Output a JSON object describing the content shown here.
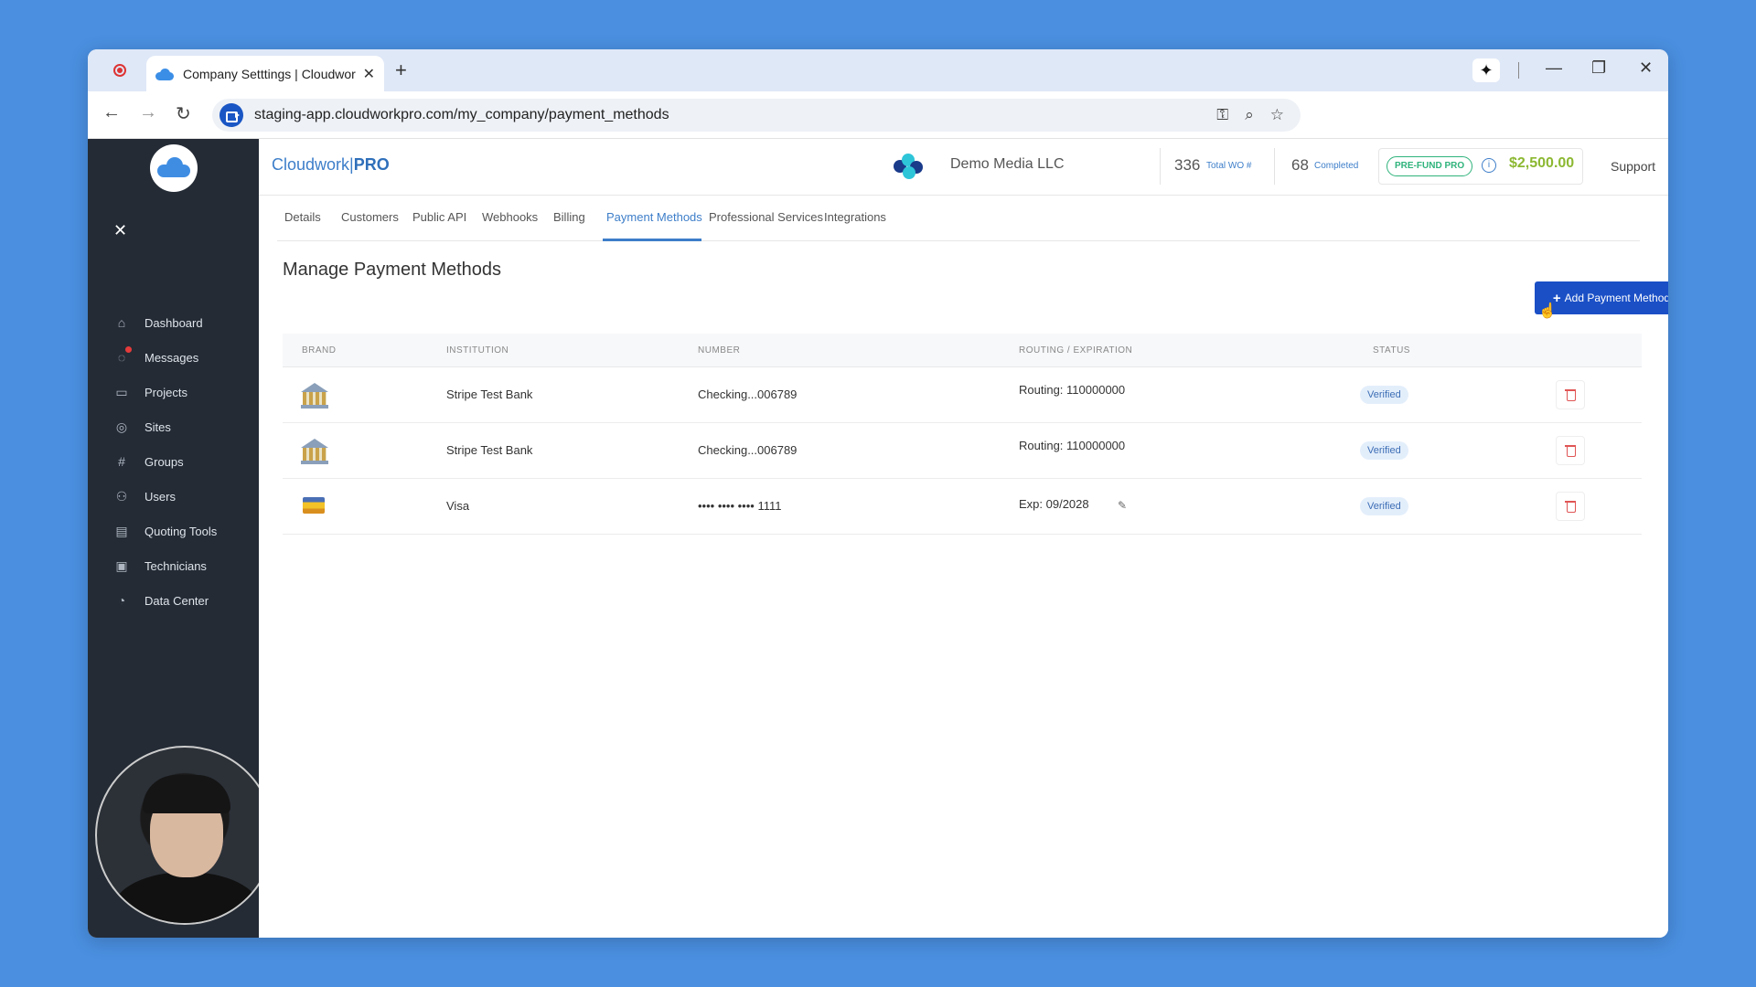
{
  "browser": {
    "tab_title": "Company Setttings | Cloudwork",
    "url": "staging-app.cloudworkpro.com/my_company/payment_methods"
  },
  "sidebar": {
    "items": [
      {
        "label": "Dashboard",
        "icon": "home-icon"
      },
      {
        "label": "Messages",
        "icon": "chat-icon"
      },
      {
        "label": "Projects",
        "icon": "folder-icon"
      },
      {
        "label": "Sites",
        "icon": "location-pin-icon"
      },
      {
        "label": "Groups",
        "icon": "hash-icon"
      },
      {
        "label": "Users",
        "icon": "users-icon"
      },
      {
        "label": "Quoting Tools",
        "icon": "calculator-icon"
      },
      {
        "label": "Technicians",
        "icon": "id-card-icon"
      },
      {
        "label": "Data Center",
        "icon": "pie-chart-icon"
      }
    ]
  },
  "header": {
    "brand_primary": "Cloudwork|",
    "brand_bold": "PRO",
    "company": "Demo Media LLC",
    "total_wo": "336",
    "total_wo_label": "Total WO #",
    "completed": "68",
    "completed_label": "Completed",
    "prefund_label": "PRE-FUND PRO",
    "balance": "$2,500.00",
    "support": "Support"
  },
  "subtabs": [
    "Details",
    "Customers",
    "Public API",
    "Webhooks",
    "Billing",
    "Payment Methods",
    "Professional Services",
    "Integrations"
  ],
  "page": {
    "title": "Manage Payment Methods",
    "add_button": "Add Payment Method"
  },
  "table": {
    "headers": [
      "BRAND",
      "INSTITUTION",
      "NUMBER",
      "ROUTING / EXPIRATION",
      "STATUS"
    ],
    "rows": [
      {
        "brand": "bank",
        "institution": "Stripe Test Bank",
        "number": "Checking...006789",
        "routing": "Routing: 110000000",
        "status": "Verified"
      },
      {
        "brand": "bank",
        "institution": "Stripe Test Bank",
        "number": "Checking...006789",
        "routing": "Routing: 110000000",
        "status": "Verified"
      },
      {
        "brand": "card",
        "institution": "Visa",
        "number": "•••• •••• •••• 1111",
        "routing": "Exp: 09/2028",
        "status": "Verified"
      }
    ]
  },
  "colors": {
    "accent": "#1a4fc6",
    "sidebar_bg": "#242b35",
    "balance": "#8cb832",
    "prefund": "#2fb37c"
  }
}
